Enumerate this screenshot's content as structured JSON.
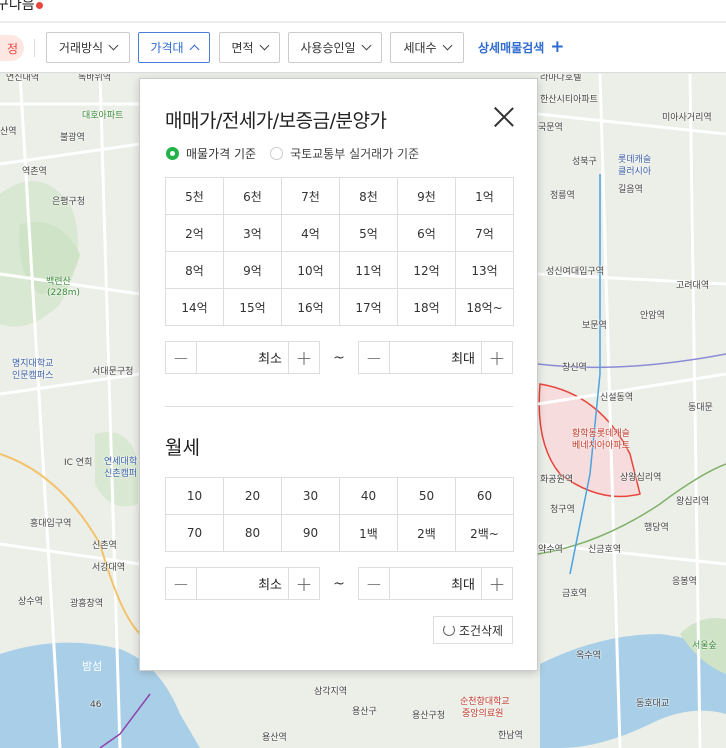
{
  "header": {
    "title": "구다음"
  },
  "filters": {
    "reset": "정",
    "deal_type": "거래방식",
    "price": "가격대",
    "area": "면적",
    "approval": "사용승인일",
    "households": "세대수",
    "detail_search": "상세매물검색"
  },
  "modal": {
    "title": "매매가/전세가/보증금/분양가",
    "radio_listing": "매물가격 기준",
    "radio_actual": "국토교통부 실거래가 기준",
    "price_options": [
      "5천",
      "6천",
      "7천",
      "8천",
      "9천",
      "1억",
      "2억",
      "3억",
      "4억",
      "5억",
      "6억",
      "7억",
      "8억",
      "9억",
      "10억",
      "11억",
      "12억",
      "13억",
      "14억",
      "15억",
      "16억",
      "17억",
      "18억",
      "18억~"
    ],
    "min_label": "최소",
    "max_label": "최대",
    "tilde": "~",
    "monthly_title": "월세",
    "monthly_options": [
      "10",
      "20",
      "30",
      "40",
      "50",
      "60",
      "70",
      "80",
      "90",
      "1백",
      "2백",
      "2백~"
    ],
    "clear_label": "조건삭제"
  },
  "map": {
    "labels": [
      "연신내역",
      "독바위역",
      "대호아파트",
      "불광역",
      "산역",
      "역촌역",
      "은평구청",
      "백련산",
      "(228m)",
      "명지대학교",
      "인문캠퍼스",
      "서대문구청",
      "IC 연희",
      "연세대학",
      "신촌캠퍼",
      "홍대입구역",
      "신촌역",
      "서강대역",
      "상수역",
      "광흥창역",
      "밤섬",
      "46",
      "삼각지역",
      "용산구",
      "용산구청",
      "용산역",
      "순천향대학교",
      "중앙의료원",
      "한남역",
      "라마다호텔",
      "한산시티아파트",
      "미아사거리역",
      "국문역",
      "성북구",
      "롯데캐슬",
      "클러시아",
      "길음역",
      "정릉역",
      "성신여대입구역",
      "고려대역",
      "보문역",
      "안암역",
      "창신역",
      "신설동역",
      "동대문",
      "황학동롯데캐슬",
      "베네치아아파트",
      "화공원역",
      "청구역",
      "상왕십리역",
      "왕십리역",
      "행당역",
      "신금호역",
      "약수역",
      "금호역",
      "응봉역",
      "옥수역",
      "동호대교",
      "서울숲"
    ]
  }
}
